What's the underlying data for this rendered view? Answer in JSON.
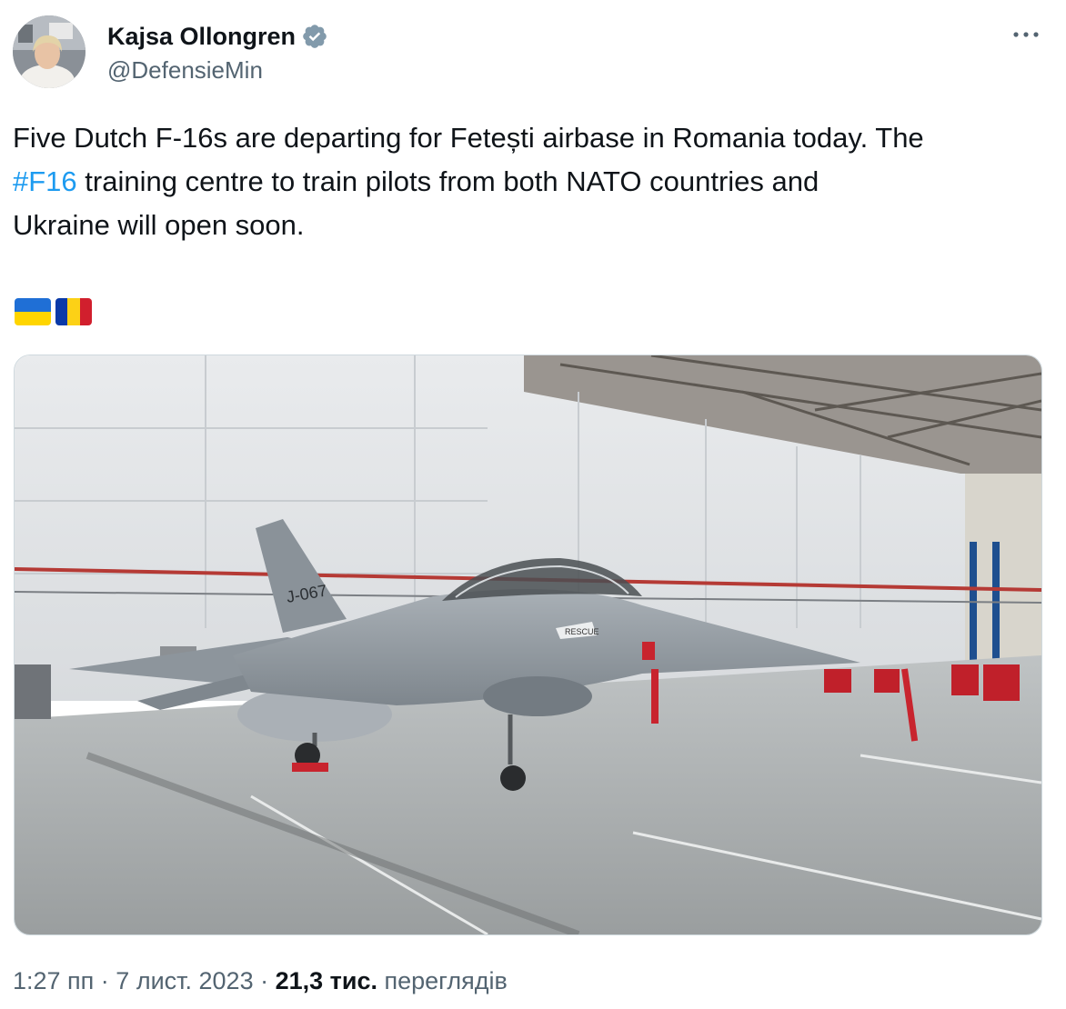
{
  "author": {
    "name": "Kajsa Ollongren",
    "handle": "@DefensieMin",
    "verified": true
  },
  "tweet": {
    "line1": "Five Dutch F-16s are departing for Fetești airbase in Romania today. The",
    "hashtag": "#F16",
    "line2_rest": " training centre to train pilots from both NATO countries and",
    "line3": "Ukraine will open soon.",
    "flags": [
      "ukraine-flag",
      "romania-flag"
    ]
  },
  "media": {
    "aircraft_marking": "J-067",
    "rescue_label": "RESCUE"
  },
  "meta": {
    "time": "1:27 пп",
    "separator": " · ",
    "date": "7 лист. 2023",
    "views_count": "21,3 тис.",
    "views_label": " переглядів"
  },
  "colors": {
    "hashtag": "#1d9bf0",
    "verified": "#829aab",
    "secondary_text": "#536471"
  }
}
